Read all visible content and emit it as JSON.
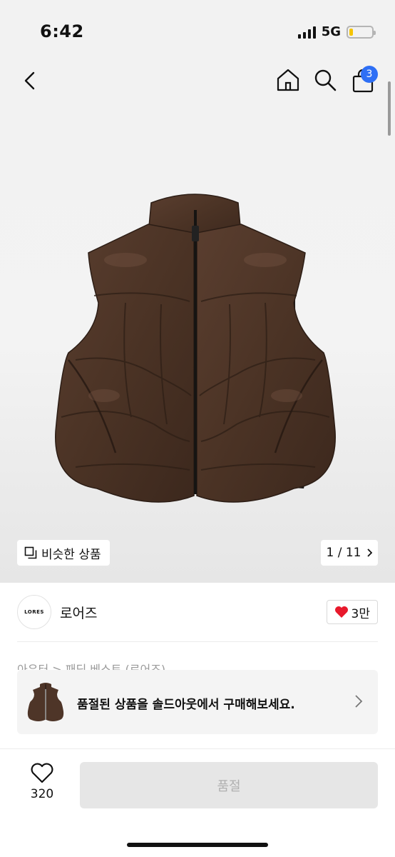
{
  "status": {
    "time": "6:42",
    "network": "5G",
    "battery_level": 0.15,
    "battery_color": "#f5c400"
  },
  "nav": {
    "cart_count": "3",
    "badge_color": "#2e6ff5"
  },
  "gallery": {
    "similar_label": "비슷한 상품",
    "pager": "1 / 11"
  },
  "brand": {
    "logo_text": "LORES",
    "name": "로어즈",
    "likes": "3만"
  },
  "breadcrumb": {
    "text": "아우터 > 패딩 베스트 (로어즈)"
  },
  "soldout_banner": {
    "text": "품절된 상품을 솔드아웃에서 구매해보세요."
  },
  "bottom_bar": {
    "favorite_count": "320",
    "buy_button": "품절"
  },
  "colors": {
    "like_red": "#e8192c",
    "product_brown": "#4e3528"
  }
}
